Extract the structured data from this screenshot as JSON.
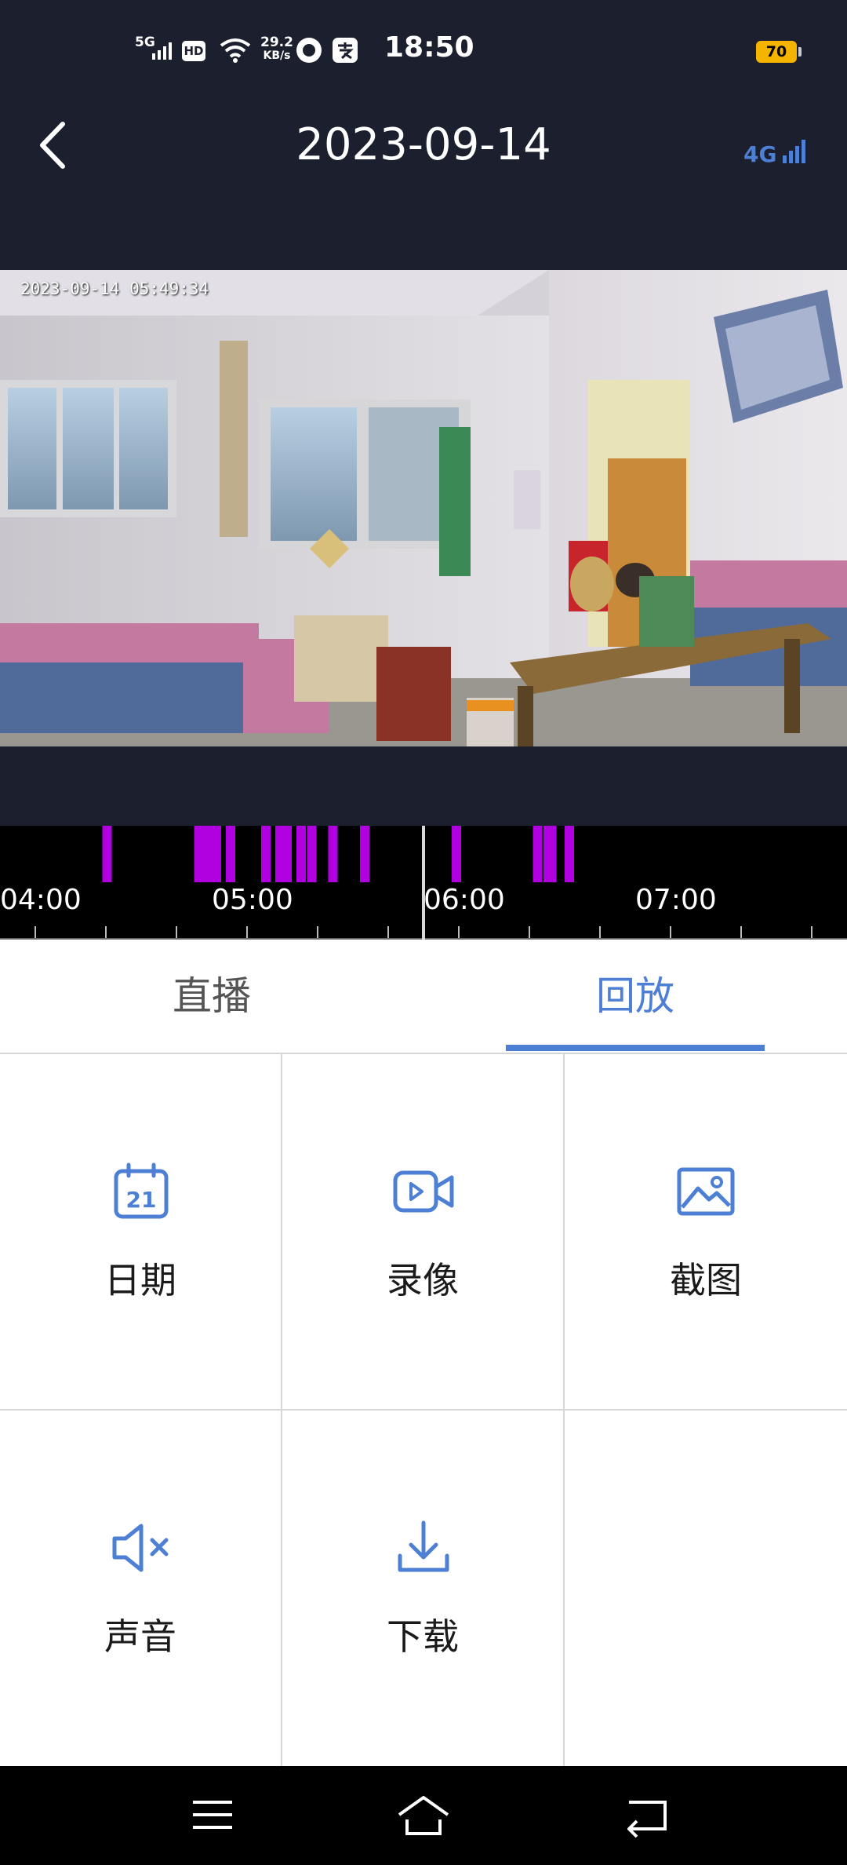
{
  "status_bar": {
    "time": "18:50",
    "network": "5G",
    "hd_badge": "HD",
    "speed_value": "29.2",
    "speed_unit": "KB/s",
    "battery": "70",
    "battery_color": "#f5b400"
  },
  "header": {
    "title": "2023-09-14",
    "signal_label": "4G"
  },
  "video": {
    "timestamp": "2023-09-14 05:49:34"
  },
  "timeline": {
    "labels": [
      "04:00",
      "05:00",
      "06:00",
      "07:00"
    ],
    "segment_color": "#b000e0",
    "events": [
      "04:29",
      "04:55",
      "04:57",
      "04:58",
      "05:00",
      "05:04",
      "05:14",
      "05:18",
      "05:20",
      "05:24",
      "05:27",
      "05:33",
      "05:42",
      "06:08",
      "06:31",
      "06:34",
      "06:35",
      "06:40"
    ]
  },
  "tabs": {
    "live_label": "直播",
    "playback_label": "回放",
    "active": "playback",
    "accent": "#4d7fd4"
  },
  "actions": {
    "date_label": "日期",
    "date_icon_text": "21",
    "record_label": "录像",
    "screenshot_label": "截图",
    "sound_label": "声音",
    "download_label": "下载",
    "icon_color": "#4d7fd4"
  }
}
